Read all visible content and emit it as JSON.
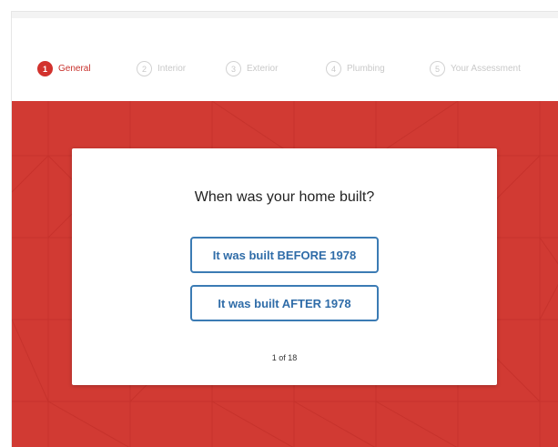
{
  "steps": [
    {
      "number": "1",
      "label": "General",
      "active": true
    },
    {
      "number": "2",
      "label": "Interior",
      "active": false
    },
    {
      "number": "3",
      "label": "Exterior",
      "active": false
    },
    {
      "number": "4",
      "label": "Plumbing",
      "active": false
    },
    {
      "number": "5",
      "label": "Your Assessment",
      "active": false
    }
  ],
  "card": {
    "question": "When was your home built?",
    "option_before": "It was built BEFORE 1978",
    "option_after": "It was built AFTER 1978",
    "progress": "1 of 18"
  },
  "colors": {
    "brand_red": "#d13a33",
    "active_step": "#d2322d",
    "button_blue": "#3b7bb4"
  }
}
